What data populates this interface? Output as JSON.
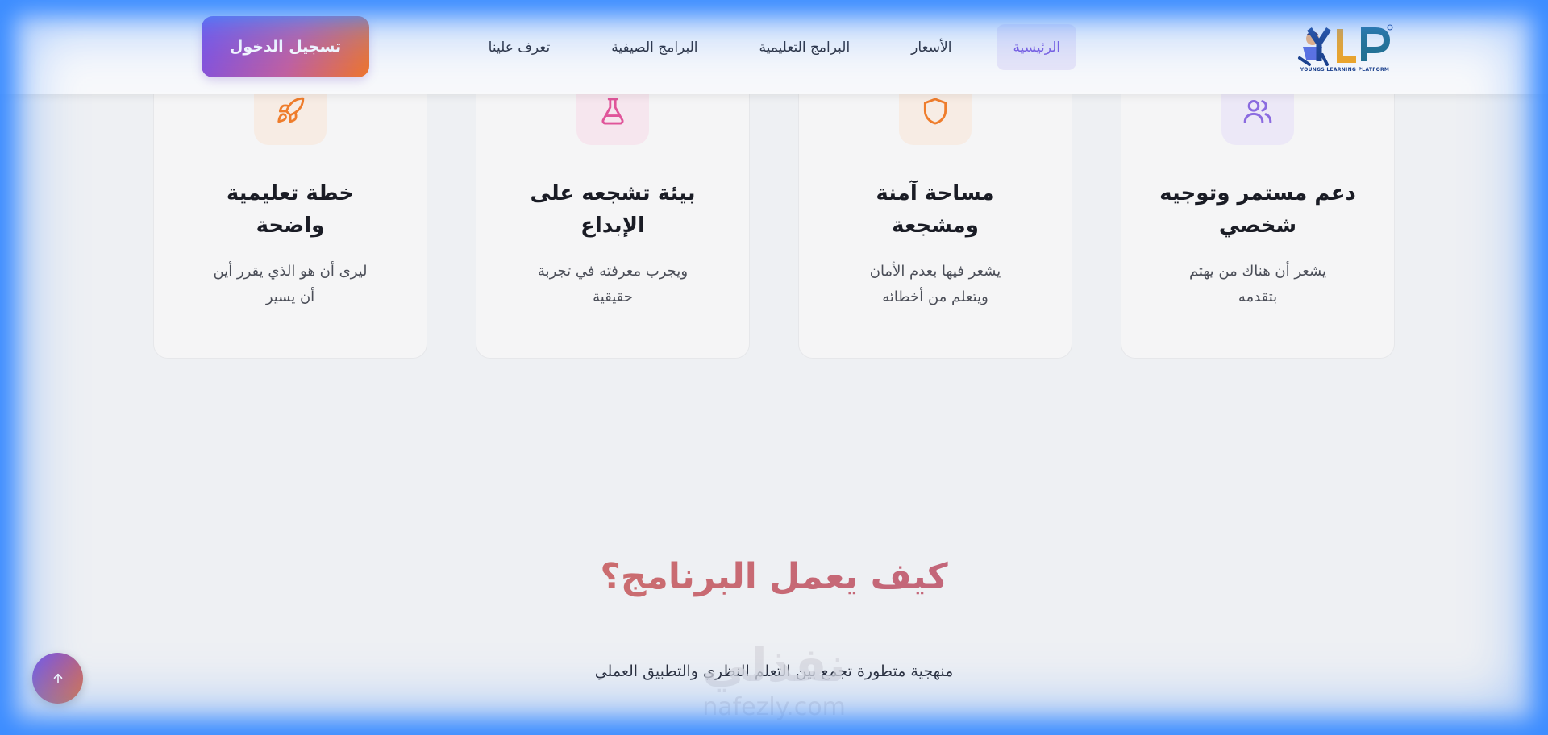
{
  "header": {
    "logo_text": "YLP",
    "logo_tagline": "YOUNGS LEARNING PLATFORM",
    "nav": [
      {
        "label": "الرئيسية",
        "active": true
      },
      {
        "label": "الأسعار",
        "active": false
      },
      {
        "label": "البرامج التعليمية",
        "active": false
      },
      {
        "label": "البرامج الصيفية",
        "active": false
      },
      {
        "label": "تعرف علينا",
        "active": false
      }
    ],
    "login_label": "تسجيل الدخول"
  },
  "features": [
    {
      "icon": "users-icon",
      "title": "دعم مستمر وتوجيه\nشخصي",
      "desc": "يشعر أن هناك من يهتم\nبتقدمه",
      "color": "#8b6be0",
      "bg": "#ece8f7"
    },
    {
      "icon": "shield-icon",
      "title": "مساحة آمنة\nومشجعة",
      "desc": "يشعر فيها بعدم الأمان\nويتعلم من أخطائه",
      "color": "#ef7d2c",
      "bg": "#f7ece4"
    },
    {
      "icon": "flask-icon",
      "title": "بيئة تشجعه على\nالإبداع",
      "desc": "ويجرب معرفته في تجربة\nحقيقية",
      "color": "#e0559a",
      "bg": "#f6e6ee"
    },
    {
      "icon": "rocket-icon",
      "title": "خطة تعليمية\nواضحة",
      "desc": "ليرى أن هو الذي يقرر أين\nأن يسير",
      "color": "#ef7d2c",
      "bg": "#f7ece4"
    }
  ],
  "how": {
    "title": "كيف يعمل البرنامج؟",
    "subtitle": "منهجية متطورة تجمع بين التعلم النظري والتطبيق العملي"
  },
  "watermark": {
    "ar": "نفذلي",
    "en": "nafezly.com"
  },
  "colors": {
    "accent": "#7b5ce0",
    "frame": "#3b8cff"
  }
}
